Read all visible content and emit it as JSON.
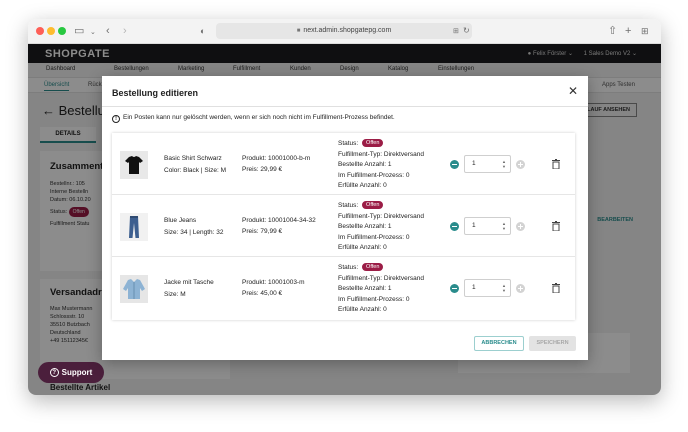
{
  "browser": {
    "url": "next.admin.shopgatepg.com"
  },
  "app": {
    "logo": "SHOPGATE",
    "user": "Felix Förster ⌄",
    "shop": "1 Sales Demo V2 ⌄",
    "nav": [
      "Dashboard",
      "Bestellungen",
      "Marketing",
      "Fulfillment",
      "Kunden",
      "Design",
      "Katalog",
      "Einstellungen"
    ],
    "subnav": [
      "Übersicht",
      "Rück"
    ],
    "apps_label": "Apps Testen"
  },
  "background": {
    "title": "Bestellu",
    "top_button": "LAUF ANSEHEN",
    "tab": "DETAILS",
    "summary_heading": "Zusamment",
    "summary_lines": [
      "Bestellnr.: 105",
      "Interne Bestelln",
      "Datum: 06.10.20"
    ],
    "status_label": "Status:",
    "status_badge": "Offen",
    "fulfillment_status": "Fulfillment Statu",
    "edit_link": "BEARBEITEN",
    "shipping_heading": "Versandadr",
    "shipping_lines": [
      "Max Mustermann",
      "Schlossstr. 10",
      "35510 Butzbach",
      "Deutschland",
      "+49 15112345€"
    ],
    "items_heading": "Bestellte Artikel"
  },
  "support": {
    "label": "Support"
  },
  "modal": {
    "title": "Bestellung editieren",
    "notice": "Ein Posten kann nur gelöscht werden, wenn er sich noch nicht im Fulfillment-Prozess befindet.",
    "cancel_label": "ABBRECHEN",
    "save_label": "SPEICHERN",
    "items": [
      {
        "name": "Basic Shirt Schwarz",
        "variant": "Color: Black | Size: M",
        "sku": "Produkt: 10001000-b-m",
        "price": "Preis: 29,99 €",
        "status_label": "Status:",
        "status": "Offen",
        "fulfillment_type": "Fulfillment-Typ: Direktversand",
        "ordered": "Bestellte Anzahl: 1",
        "in_process": "Im Fulfillment-Prozess: 0",
        "fulfilled": "Erfüllte Anzahl: 0",
        "quantity": "1",
        "thumb": "tshirt"
      },
      {
        "name": "Blue Jeans",
        "variant": "Size: 34 | Length: 32",
        "sku": "Produkt: 10001004-34-32",
        "price": "Preis: 79,99 €",
        "status_label": "Status:",
        "status": "Offen",
        "fulfillment_type": "Fulfillment-Typ: Direktversand",
        "ordered": "Bestellte Anzahl: 1",
        "in_process": "Im Fulfillment-Prozess: 0",
        "fulfilled": "Erfüllte Anzahl: 0",
        "quantity": "1",
        "thumb": "jeans"
      },
      {
        "name": "Jacke mit Tasche",
        "variant": "Size: M",
        "sku": "Produkt: 10001003-m",
        "price": "Preis: 45,00 €",
        "status_label": "Status:",
        "status": "Offen",
        "fulfillment_type": "Fulfillment-Typ: Direktversand",
        "ordered": "Bestellte Anzahl: 1",
        "in_process": "Im Fulfillment-Prozess: 0",
        "fulfilled": "Erfüllte Anzahl: 0",
        "quantity": "1",
        "thumb": "jacket"
      }
    ]
  },
  "colors": {
    "accent": "#2a8c8c",
    "badge": "#9b1d46",
    "header": "#1d1d1f"
  }
}
